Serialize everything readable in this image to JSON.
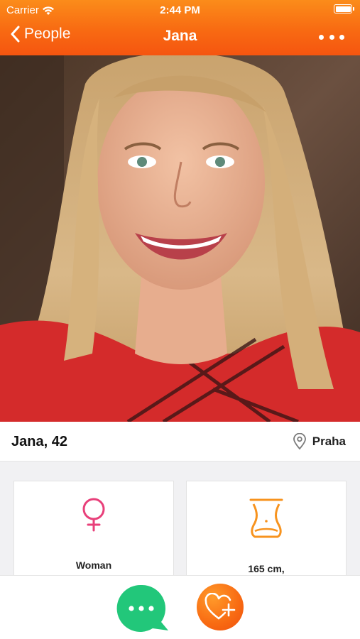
{
  "status_bar": {
    "carrier": "Carrier",
    "time": "2:44 PM",
    "icons": [
      "wifi-icon",
      "battery-icon"
    ]
  },
  "nav": {
    "back_label": "People",
    "title": "Jana",
    "more_icon": "more-icon"
  },
  "profile": {
    "photo_alt": "profile photo",
    "name_age": "Jana, 42",
    "location": "Praha"
  },
  "cards": [
    {
      "icon": "female-symbol-icon",
      "label": "Woman",
      "icon_color": "#e8407a"
    },
    {
      "icon": "body-icon",
      "label": "165 cm,",
      "icon_color": "#f7931e"
    }
  ],
  "actions": {
    "chat_icon": "chat-bubble-icon",
    "like_icon": "heart-plus-icon"
  },
  "colors": {
    "header_top": "#fb8c1a",
    "header_bottom": "#f55510",
    "chat_green": "#22c77a",
    "like_orange": "#f86a12",
    "card_bg": "#f1f1f3"
  }
}
